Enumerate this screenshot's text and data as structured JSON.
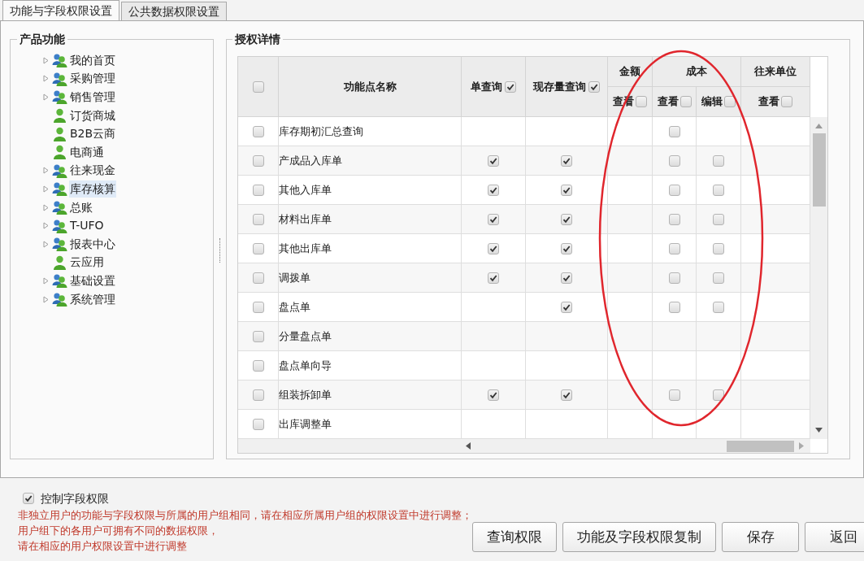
{
  "tabs": [
    {
      "label": "功能与字段权限设置",
      "selected": true
    },
    {
      "label": "公共数据权限设置",
      "selected": false
    }
  ],
  "product_panel": {
    "title": "产品功能",
    "tree": [
      {
        "label": "我的首页",
        "kind": "group",
        "selected": false
      },
      {
        "label": "采购管理",
        "kind": "group",
        "selected": false
      },
      {
        "label": "销售管理",
        "kind": "group",
        "selected": false
      },
      {
        "label": "订货商城",
        "kind": "single",
        "selected": false
      },
      {
        "label": "B2B云商",
        "kind": "single",
        "selected": false
      },
      {
        "label": "电商通",
        "kind": "single",
        "selected": false
      },
      {
        "label": "往来现金",
        "kind": "group",
        "selected": false
      },
      {
        "label": "库存核算",
        "kind": "group",
        "selected": true
      },
      {
        "label": "总账",
        "kind": "group",
        "selected": false
      },
      {
        "label": "T-UFO",
        "kind": "group",
        "selected": false
      },
      {
        "label": "报表中心",
        "kind": "group",
        "selected": false
      },
      {
        "label": "云应用",
        "kind": "single",
        "selected": false
      },
      {
        "label": "基础设置",
        "kind": "group",
        "selected": false
      },
      {
        "label": "系统管理",
        "kind": "group",
        "selected": false
      }
    ]
  },
  "detail_panel": {
    "title": "授权详情",
    "table": {
      "select_all": {
        "checked": false
      },
      "name_column": "功能点名称",
      "columns": [
        {
          "label": "单查询",
          "checked": true
        },
        {
          "label": "现存量查询",
          "checked": true
        }
      ],
      "groups": [
        {
          "label": "金额",
          "subcolumns": [
            {
              "label": "查看",
              "checked": false
            }
          ]
        },
        {
          "label": "成本",
          "subcolumns": [
            {
              "label": "查看",
              "checked": false
            },
            {
              "label": "编辑",
              "checked": false
            }
          ]
        },
        {
          "label": "往来单位",
          "subcolumns": [
            {
              "label": "查看",
              "checked": false
            }
          ]
        }
      ],
      "rows": [
        {
          "checked": false,
          "name": "库存期初汇总查询",
          "cells": [
            {
              "kind": "empty"
            },
            {
              "kind": "empty"
            },
            {
              "kind": "empty"
            },
            {
              "kind": "checkbox",
              "checked": false
            },
            {
              "kind": "empty"
            },
            {
              "kind": "empty"
            }
          ]
        },
        {
          "checked": false,
          "name": "产成品入库单",
          "cells": [
            {
              "kind": "checkbox",
              "checked": true
            },
            {
              "kind": "checkbox",
              "checked": true
            },
            {
              "kind": "empty"
            },
            {
              "kind": "checkbox",
              "checked": false
            },
            {
              "kind": "checkbox",
              "checked": false
            },
            {
              "kind": "empty"
            }
          ]
        },
        {
          "checked": false,
          "name": "其他入库单",
          "cells": [
            {
              "kind": "checkbox",
              "checked": true
            },
            {
              "kind": "checkbox",
              "checked": true
            },
            {
              "kind": "empty"
            },
            {
              "kind": "checkbox",
              "checked": false
            },
            {
              "kind": "checkbox",
              "checked": false
            },
            {
              "kind": "empty"
            }
          ]
        },
        {
          "checked": false,
          "name": "材料出库单",
          "cells": [
            {
              "kind": "checkbox",
              "checked": true
            },
            {
              "kind": "checkbox",
              "checked": true
            },
            {
              "kind": "empty"
            },
            {
              "kind": "checkbox",
              "checked": false
            },
            {
              "kind": "checkbox",
              "checked": false
            },
            {
              "kind": "empty"
            }
          ]
        },
        {
          "checked": false,
          "name": "其他出库单",
          "cells": [
            {
              "kind": "checkbox",
              "checked": true
            },
            {
              "kind": "checkbox",
              "checked": true
            },
            {
              "kind": "empty"
            },
            {
              "kind": "checkbox",
              "checked": false
            },
            {
              "kind": "checkbox",
              "checked": false
            },
            {
              "kind": "empty"
            }
          ]
        },
        {
          "checked": false,
          "name": "调拨单",
          "cells": [
            {
              "kind": "checkbox",
              "checked": true
            },
            {
              "kind": "checkbox",
              "checked": true
            },
            {
              "kind": "empty"
            },
            {
              "kind": "checkbox",
              "checked": false
            },
            {
              "kind": "checkbox",
              "checked": false
            },
            {
              "kind": "empty"
            }
          ]
        },
        {
          "checked": false,
          "name": "盘点单",
          "cells": [
            {
              "kind": "empty"
            },
            {
              "kind": "checkbox",
              "checked": true
            },
            {
              "kind": "empty"
            },
            {
              "kind": "checkbox",
              "checked": false
            },
            {
              "kind": "checkbox",
              "checked": false
            },
            {
              "kind": "empty"
            }
          ]
        },
        {
          "checked": false,
          "name": "分量盘点单",
          "cells": [
            {
              "kind": "empty"
            },
            {
              "kind": "empty"
            },
            {
              "kind": "empty"
            },
            {
              "kind": "empty"
            },
            {
              "kind": "empty"
            },
            {
              "kind": "empty"
            }
          ]
        },
        {
          "checked": false,
          "name": "盘点单向导",
          "cells": [
            {
              "kind": "empty"
            },
            {
              "kind": "empty"
            },
            {
              "kind": "empty"
            },
            {
              "kind": "empty"
            },
            {
              "kind": "empty"
            },
            {
              "kind": "empty"
            }
          ]
        },
        {
          "checked": false,
          "name": "组装拆卸单",
          "cells": [
            {
              "kind": "checkbox",
              "checked": true
            },
            {
              "kind": "checkbox",
              "checked": true
            },
            {
              "kind": "empty"
            },
            {
              "kind": "checkbox",
              "checked": false
            },
            {
              "kind": "checkbox",
              "checked": false
            },
            {
              "kind": "empty"
            }
          ]
        },
        {
          "checked": false,
          "name": "出库调整单",
          "cells": [
            {
              "kind": "empty"
            },
            {
              "kind": "empty"
            },
            {
              "kind": "empty"
            },
            {
              "kind": "empty"
            },
            {
              "kind": "empty"
            },
            {
              "kind": "empty"
            }
          ]
        }
      ]
    }
  },
  "field_control": {
    "label": "控制字段权限",
    "checked": true
  },
  "notes": [
    "非独立用户的功能与字段权限与所属的用户组相同，请在相应所属用户组的权限设置中进行调整；",
    "用户组下的各用户可拥有不同的数据权限，",
    "请在相应的用户权限设置中进行调整"
  ],
  "buttons": [
    "查询权限",
    "功能及字段权限复制",
    "保存",
    "返回"
  ]
}
